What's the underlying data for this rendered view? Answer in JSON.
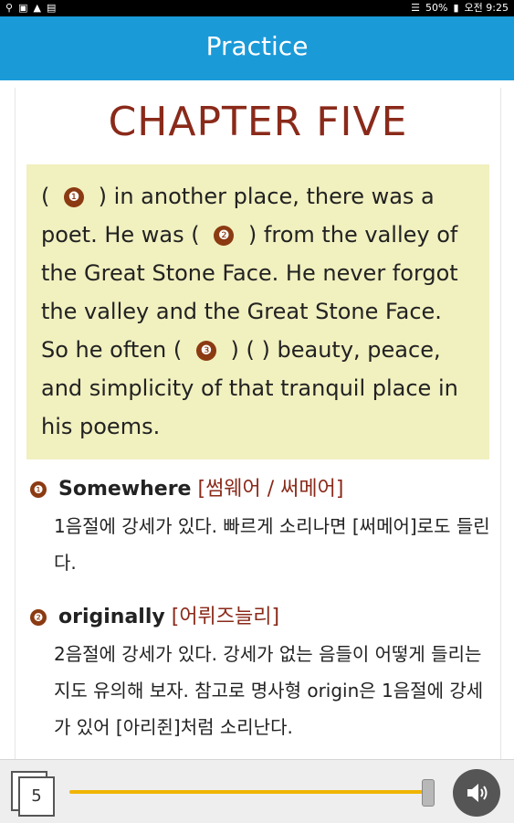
{
  "status_bar": {
    "left_icons": [
      "usb-icon",
      "image-icon",
      "warning-icon",
      "bag-icon"
    ],
    "battery": "50%",
    "time": "오전 9:25"
  },
  "app_bar": {
    "title": "Practice"
  },
  "chapter_title": "CHAPTER FIVE",
  "passage": {
    "open1": "(",
    "num1": "❶",
    "after1": ") in another place, there was a poet. He was (",
    "num2": "❷",
    "after2": ") from the valley of the Great Stone Face. He never forgot the valley and the Great Stone Face. So he often (",
    "num3": "❸",
    "after3": ") (      ) beauty, peace, and simplicity of that tranquil place in his poems."
  },
  "vocab": [
    {
      "bullet": "❶",
      "word": "Somewhere",
      "pron": "[썸웨어 / 써메어]",
      "body": "1음절에 강세가 있다. 빠르게 소리나면 [써메어]로도 들린다."
    },
    {
      "bullet": "❷",
      "word": "originally",
      "pron": "[어뤼즈늘리]",
      "body": "2음절에 강세가 있다. 강세가 없는 음들이 어떻게 들리는지도 유의해 보자. 참고로 명사형 origin은 1음절에 강세가 있어 [아리쥔]처럼 소리난다."
    }
  ],
  "bottom_bar": {
    "page_number": "5",
    "slider_value": 0.98,
    "slider_color": "#f0b500"
  }
}
